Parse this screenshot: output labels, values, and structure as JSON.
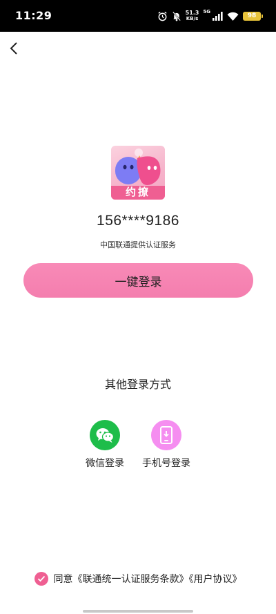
{
  "status_bar": {
    "time": "11:29",
    "net_speed_value": "51.3",
    "net_speed_unit": "KB/s",
    "network": "5G",
    "battery": "98",
    "icons": [
      "alarm-icon",
      "mute-bell-icon",
      "signal-icon",
      "wifi-icon",
      "battery-icon"
    ]
  },
  "header": {
    "back_icon": "chevron-left-icon"
  },
  "app": {
    "logo_text": "约撩",
    "logo_colors": [
      "#7d7cf4",
      "#ef4f8e",
      "#fbd2df"
    ]
  },
  "login": {
    "phone_number": "156****9186",
    "carrier_text": "中国联通提供认证服务",
    "one_click_label": "一键登录",
    "button_color": "#f584b2"
  },
  "other_methods": {
    "title": "其他登录方式",
    "options": [
      {
        "label": "微信登录",
        "icon": "wechat-icon",
        "color": "#1ebd4a"
      },
      {
        "label": "手机号登录",
        "icon": "phone-icon",
        "color": "#f58ef0"
      }
    ]
  },
  "agreement": {
    "prefix": "同意",
    "terms": "《联通统一认证服务条款》",
    "user_agreement": "《用户协议》",
    "checked": true,
    "check_color": "#ef5f92"
  }
}
